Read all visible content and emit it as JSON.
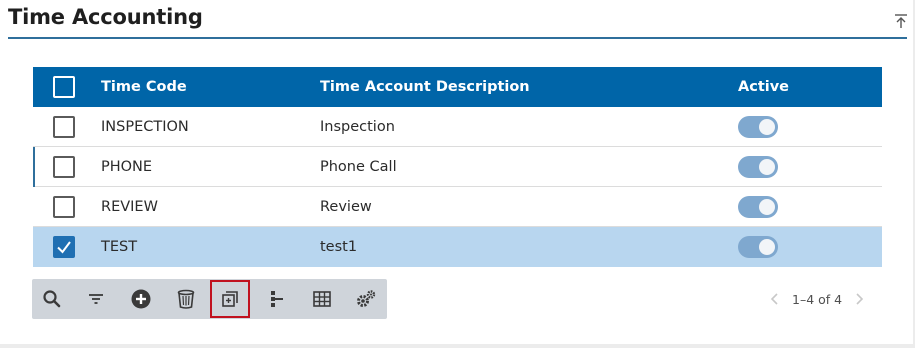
{
  "page": {
    "title": "Time Accounting"
  },
  "grid": {
    "columns": {
      "code": "Time Code",
      "description": "Time Account Description",
      "active": "Active"
    },
    "rows": [
      {
        "code": "INSPECTION",
        "description": "Inspection",
        "active": true,
        "selected": false
      },
      {
        "code": "PHONE",
        "description": "Phone Call",
        "active": true,
        "selected": false
      },
      {
        "code": "REVIEW",
        "description": "Review",
        "active": true,
        "selected": false
      },
      {
        "code": "TEST",
        "description": "test1",
        "active": true,
        "selected": true
      }
    ]
  },
  "toolbar": {
    "buttons": [
      "search-icon",
      "filter-icon",
      "add-icon",
      "delete-icon",
      "copy-record-icon",
      "hierarchy-icon",
      "table-view-icon",
      "settings-icon"
    ],
    "highlighted": "copy-record-icon"
  },
  "pager": {
    "text": "1–4 of 4"
  },
  "colors": {
    "header": "#0065a8",
    "selected_row": "#b8d6ef",
    "toggle_on": "#7fa8cf",
    "highlight_border": "#c1121f",
    "toolbar_bg": "#cfd4da"
  }
}
